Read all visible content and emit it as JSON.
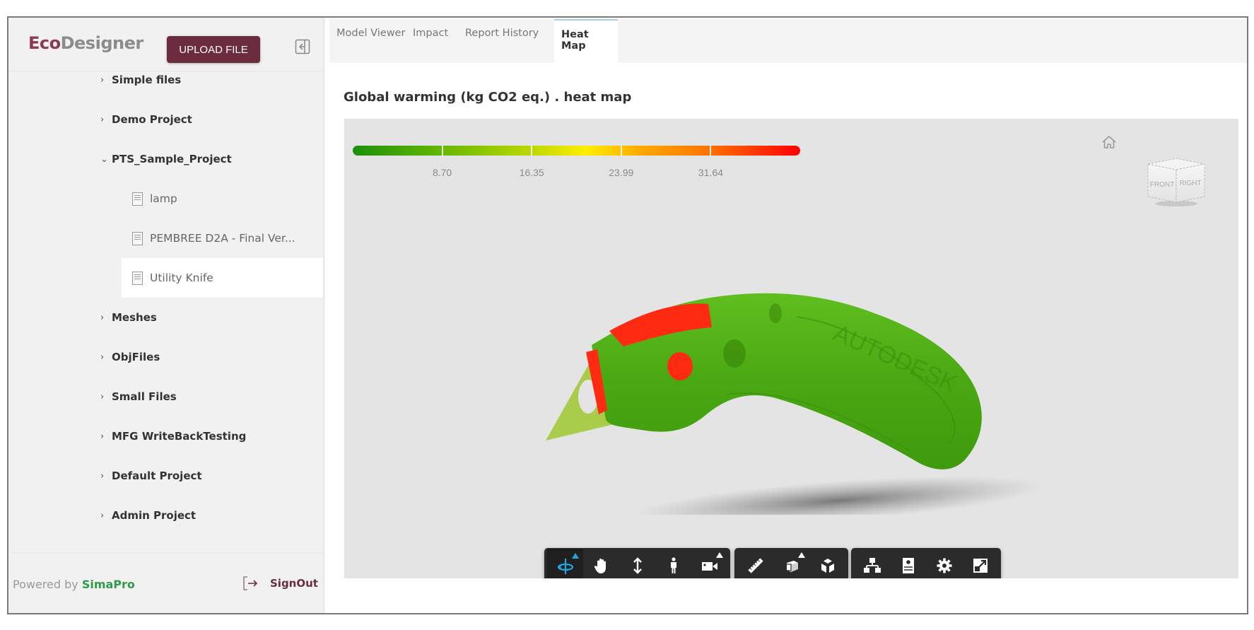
{
  "app": {
    "brand_eco": "Eco",
    "brand_designer": "Designer",
    "upload_label": "UPLOAD FILE",
    "brand_colors": {
      "primary": "#6b2c3e",
      "eco": "#8b3a52",
      "simapro": "#2f9b4c"
    }
  },
  "sidebar": {
    "items": [
      {
        "type": "folder",
        "label": "Simple files",
        "expanded": false
      },
      {
        "type": "folder",
        "label": "Demo Project",
        "expanded": false
      },
      {
        "type": "folder",
        "label": "PTS_Sample_Project",
        "expanded": true
      },
      {
        "type": "file",
        "label": "lamp",
        "selected": false
      },
      {
        "type": "file",
        "label": "PEMBREE D2A - Final Ver...",
        "selected": false
      },
      {
        "type": "file",
        "label": "Utility Knife",
        "selected": true
      },
      {
        "type": "folder",
        "label": "Meshes",
        "expanded": false
      },
      {
        "type": "folder",
        "label": "ObjFiles",
        "expanded": false
      },
      {
        "type": "folder",
        "label": "Small Files",
        "expanded": false
      },
      {
        "type": "folder",
        "label": "MFG WriteBackTesting",
        "expanded": false
      },
      {
        "type": "folder",
        "label": "Default Project",
        "expanded": false
      },
      {
        "type": "folder",
        "label": "Admin Project",
        "expanded": false
      }
    ],
    "chevron_collapsed": "›",
    "chevron_expanded": "⌄",
    "footer": {
      "powered_by": "Powered by ",
      "simapro": "SimaPro",
      "signout_label": "SignOut"
    }
  },
  "tabs": [
    {
      "label": "Model Viewer",
      "active": false
    },
    {
      "label": "Impact",
      "active": false
    },
    {
      "label": "Report History",
      "active": false
    },
    {
      "label": "Heat Map",
      "active": true
    }
  ],
  "panel": {
    "title": "Global warming (kg CO2 eq.) . heat map"
  },
  "heatmap_legend": {
    "tick_labels": [
      "8.70",
      "16.35",
      "23.99",
      "31.64"
    ],
    "segments": 5,
    "color_low": "#1a8f0a",
    "color_mid": "#ffee00",
    "color_high": "#ff0000"
  },
  "viewer": {
    "view_cube_faces": {
      "front": "FRONT",
      "right": "RIGHT"
    },
    "model_name": "Utility Knife",
    "model_watermark": "AUTODESK",
    "toolbar": {
      "groups": [
        [
          {
            "icon": "orbit-icon",
            "label": "Orbit",
            "active": true,
            "submenu": true
          },
          {
            "icon": "pan-icon",
            "label": "Pan",
            "active": false,
            "submenu": false
          },
          {
            "icon": "zoom-icon",
            "label": "Zoom",
            "active": false,
            "submenu": false
          },
          {
            "icon": "first-person-icon",
            "label": "First person",
            "active": false,
            "submenu": false
          },
          {
            "icon": "camera-icon",
            "label": "Camera interactions",
            "active": false,
            "submenu": true
          }
        ],
        [
          {
            "icon": "measure-icon",
            "label": "Measure",
            "active": false,
            "submenu": false
          },
          {
            "icon": "section-analysis-icon",
            "label": "Section analysis",
            "active": false,
            "submenu": true
          },
          {
            "icon": "explode-icon",
            "label": "Explode model",
            "active": false,
            "submenu": false
          }
        ],
        [
          {
            "icon": "model-browser-icon",
            "label": "Model browser",
            "active": false,
            "submenu": false
          },
          {
            "icon": "properties-icon",
            "label": "Properties",
            "active": false,
            "submenu": false
          },
          {
            "icon": "settings-icon",
            "label": "Settings",
            "active": false,
            "submenu": false
          },
          {
            "icon": "fullscreen-icon",
            "label": "Full screen",
            "active": false,
            "submenu": false
          }
        ]
      ],
      "active_color": "#1ea7dd"
    }
  }
}
